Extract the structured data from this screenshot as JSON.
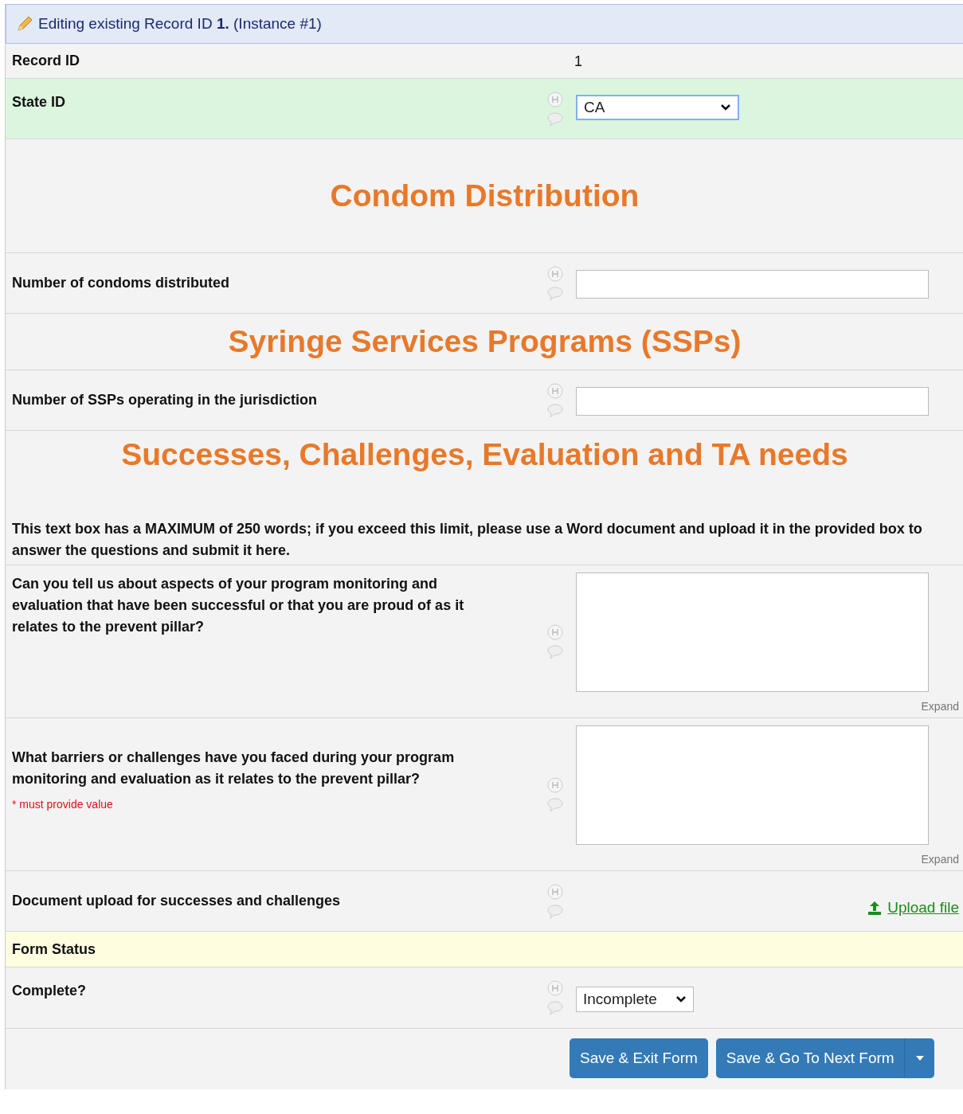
{
  "edit_banner": "Editing existing Record ID **1.** (Instance #1)",
  "rows": [
    {
      "kind": "readonly",
      "label": "Record ID",
      "value": "1"
    },
    {
      "kind": "select",
      "label": "State ID",
      "value": "CA",
      "highlighted": true
    },
    {
      "kind": "section",
      "title": "Condom Distribution"
    },
    {
      "kind": "text",
      "label": "Number of condoms distributed"
    },
    {
      "kind": "section",
      "title": "Syringe Services Programs (SSPs)"
    },
    {
      "kind": "text",
      "label": "Number of SSPs operating in the jurisdiction"
    },
    {
      "kind": "section",
      "title": "Successes, Challenges, Evaluation and TA needs"
    },
    {
      "kind": "note",
      "text": "This text box has a MAXIMUM of 250 words; if you exceed this limit, please use a Word document and upload it in the provided box to answer the questions and submit it here."
    },
    {
      "kind": "textarea",
      "label": "Can you tell us about aspects of your program monitoring and evaluation that have been successful or that you are proud of as it relates to the prevent pillar?",
      "expand": "Expand"
    },
    {
      "kind": "textarea",
      "label": "What barriers or challenges have you faced during your program monitoring and evaluation as it relates to the prevent pillar?",
      "required_note": "* must provide value",
      "expand": "Expand"
    },
    {
      "kind": "upload",
      "label": "Document upload for successes and challenges",
      "link": "Upload file"
    },
    {
      "kind": "status_header",
      "title": "Form Status"
    },
    {
      "kind": "select",
      "label": "Complete?",
      "value": "Incomplete",
      "highlighted": false
    }
  ],
  "buttons": [
    "Save & Exit Form",
    "Save & Go To Next Form"
  ]
}
